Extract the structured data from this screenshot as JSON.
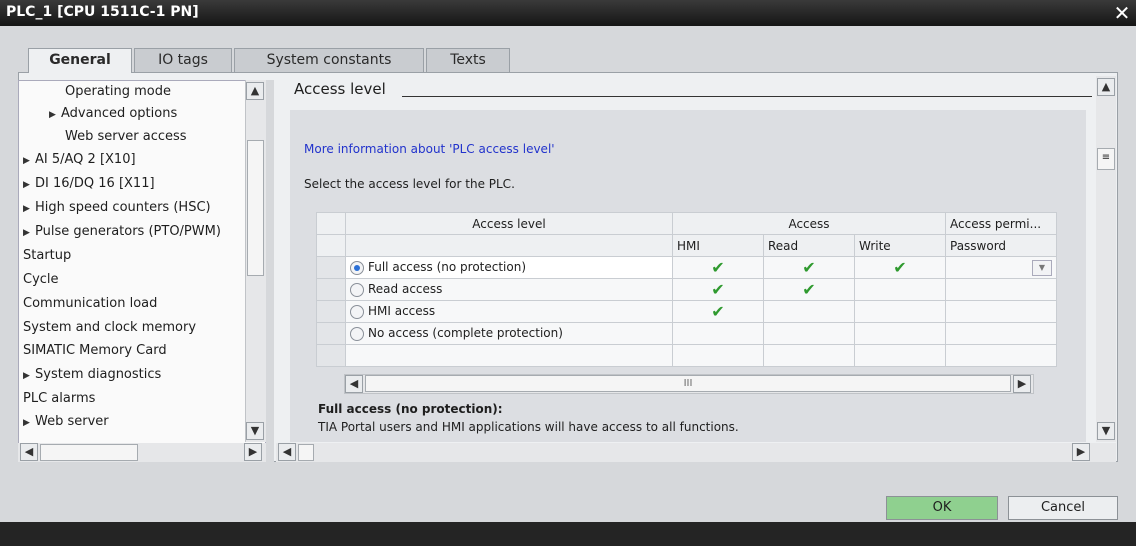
{
  "window": {
    "title": "PLC_1 [CPU 1511C-1 PN]",
    "close_glyph": "✕"
  },
  "tabs": [
    {
      "label": "General",
      "active": true
    },
    {
      "label": "IO tags",
      "active": false
    },
    {
      "label": "System constants",
      "active": false
    },
    {
      "label": "Texts",
      "active": false
    }
  ],
  "tree": [
    {
      "label": "Operating mode",
      "expandable": false
    },
    {
      "label": "Advanced options",
      "expandable": true
    },
    {
      "label": "Web server access",
      "expandable": false
    },
    {
      "label": "AI 5/AQ 2 [X10]",
      "expandable": true
    },
    {
      "label": "DI 16/DQ 16 [X11]",
      "expandable": true
    },
    {
      "label": "High speed counters (HSC)",
      "expandable": true
    },
    {
      "label": "Pulse generators (PTO/PWM)",
      "expandable": true
    },
    {
      "label": "Startup",
      "expandable": false
    },
    {
      "label": "Cycle",
      "expandable": false
    },
    {
      "label": "Communication load",
      "expandable": false
    },
    {
      "label": "System and clock memory",
      "expandable": false
    },
    {
      "label": "SIMATIC Memory Card",
      "expandable": false
    },
    {
      "label": "System diagnostics",
      "expandable": true
    },
    {
      "label": "PLC alarms",
      "expandable": false
    },
    {
      "label": "Web server",
      "expandable": true
    }
  ],
  "section": {
    "title": "Access level",
    "link": "More information about 'PLC access level'",
    "description": "Select the access level for the PLC."
  },
  "table": {
    "headers": {
      "access_level": "Access level",
      "access": "Access",
      "permission": "Access permi...",
      "hmi": "HMI",
      "read": "Read",
      "write": "Write",
      "password": "Password"
    },
    "rows": [
      {
        "label": "Full access (no protection)",
        "selected": true,
        "hmi": true,
        "read": true,
        "write": true
      },
      {
        "label": "Read access",
        "selected": false,
        "hmi": true,
        "read": true,
        "write": false
      },
      {
        "label": "HMI access",
        "selected": false,
        "hmi": true,
        "read": false,
        "write": false
      },
      {
        "label": "No access (complete protection)",
        "selected": false,
        "hmi": false,
        "read": false,
        "write": false
      }
    ],
    "scroll_grip": "III"
  },
  "footer": {
    "heading": "Full access (no protection):",
    "text": "TIA Portal users and HMI applications will have access to all functions."
  },
  "buttons": {
    "ok": "OK",
    "cancel": "Cancel"
  },
  "colors": {
    "check": "#2f9a2f",
    "link": "#2233cc",
    "ok_button": "#8fd08f"
  }
}
